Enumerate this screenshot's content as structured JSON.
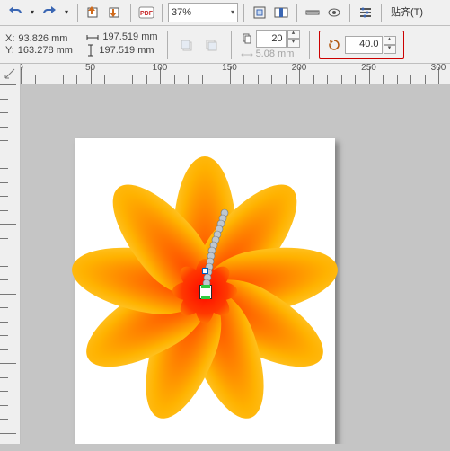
{
  "toolbar": {
    "zoom_value": "37%",
    "align_label": "贴齐(T)"
  },
  "propbar": {
    "x_label": "X:",
    "y_label": "Y:",
    "x_value": "93.826 mm",
    "y_value": "163.278 mm",
    "width_value": "197.519 mm",
    "height_value": "197.519 mm",
    "copies_value": "20",
    "spacing_value": "5.08 mm",
    "rotation_value": "40.0"
  },
  "ruler": {
    "majors": [
      0,
      50,
      100,
      150,
      200,
      250,
      300
    ]
  }
}
